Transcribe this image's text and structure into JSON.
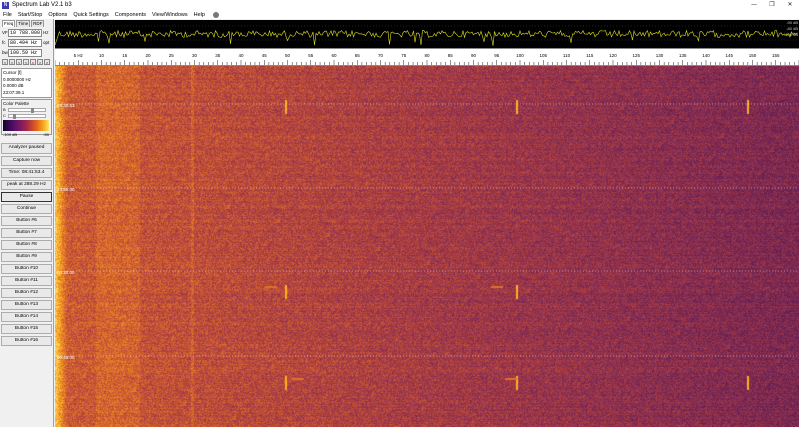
{
  "window": {
    "title": "Spectrum Lab V2.1 b3",
    "controls": {
      "minimize": "—",
      "restore": "❐",
      "close": "✕"
    }
  },
  "menu": [
    "File",
    "Start/Stop",
    "Options",
    "Quick Settings",
    "Components",
    "View/Windows",
    "Help"
  ],
  "left_panel": {
    "tabs": [
      "Freq",
      "Time",
      "RDF"
    ],
    "fields": [
      {
        "label": "VFO",
        "value": "10 788.000",
        "unit": "Hz"
      },
      {
        "label": "fc",
        "value": "80.494 Hz",
        "unit": "opt"
      },
      {
        "label": "bw",
        "value": "100.59 Hz",
        "unit": ""
      }
    ],
    "spin_buttons": [
      "<",
      "<",
      "<",
      "<",
      "x",
      ">",
      ">"
    ],
    "cursor": {
      "title": "Cursor [f]",
      "freq": "0.0000000 Hz",
      "level": "0.0000 dB",
      "time": "23:07:39.1"
    },
    "palette": {
      "title": "Color Palette",
      "slider_b": "B",
      "slider_c": "C",
      "b_value": 0.62,
      "c_value": 0.1,
      "label_min": "-100 dB",
      "label_max": "-50"
    },
    "buttons": [
      "Analyzer paused",
      "Capture now",
      "Time:  08:41:53.4",
      "peak at 288.29 Hz",
      "Pause",
      "Continue",
      "Button #6",
      "Button #7",
      "Button #8",
      "Button #9",
      "Button #10",
      "Button #11",
      "Button #12",
      "Button #13",
      "Button #14",
      "Button #15",
      "Button #16"
    ]
  },
  "spectrum": {
    "level_labels": [
      "-90 dB",
      "-80 dB",
      "-100 dB"
    ]
  },
  "scale": {
    "start": 0,
    "end": 160,
    "labels": [
      "5 Hz",
      "10",
      "15",
      "20",
      "25",
      "30",
      "35",
      "40",
      "45",
      "50",
      "55",
      "60",
      "65",
      "70",
      "75",
      "80",
      "85",
      "90",
      "95",
      "100",
      "105",
      "110",
      "115",
      "120",
      "125",
      "130",
      "135",
      "140",
      "145",
      "150",
      "155"
    ]
  },
  "waterfall": {
    "time_marks": [
      "23:30:53",
      "23:55:00",
      "00:20:00",
      "00:45:00"
    ],
    "colors": {
      "hot": "#ffb020",
      "warm": "#e0702a",
      "mid": "#b04040",
      "cool": "#7a2856"
    }
  }
}
